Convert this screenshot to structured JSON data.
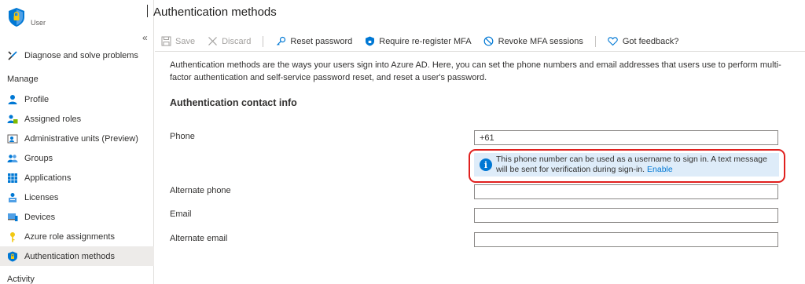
{
  "header": {
    "title": "Authentication methods",
    "user_caption": "User"
  },
  "sidebar": {
    "collapse_glyph": "«",
    "top_item": {
      "label": "Diagnose and solve problems",
      "icon": "wrench-icon"
    },
    "section_manage": "Manage",
    "items": [
      {
        "label": "Profile",
        "icon": "person-icon"
      },
      {
        "label": "Assigned roles",
        "icon": "roles-icon"
      },
      {
        "label": "Administrative units (Preview)",
        "icon": "admin-units-icon"
      },
      {
        "label": "Groups",
        "icon": "groups-icon"
      },
      {
        "label": "Applications",
        "icon": "applications-icon"
      },
      {
        "label": "Licenses",
        "icon": "licenses-icon"
      },
      {
        "label": "Devices",
        "icon": "devices-icon"
      },
      {
        "label": "Azure role assignments",
        "icon": "key-icon"
      },
      {
        "label": "Authentication methods",
        "icon": "shield-icon",
        "active": true
      }
    ],
    "section_activity": "Activity"
  },
  "toolbar": {
    "save": "Save",
    "discard": "Discard",
    "reset_password": "Reset password",
    "require_mfa": "Require re-register MFA",
    "revoke_mfa": "Revoke MFA sessions",
    "feedback": "Got feedback?"
  },
  "main": {
    "description": "Authentication methods are the ways your users sign into Azure AD. Here, you can set the phone numbers and email addresses that users use to perform multi-factor authentication and self-service password reset, and reset a user's password.",
    "section_title": "Authentication contact info",
    "phone_label": "Phone",
    "phone_value": "+61",
    "info_text": "This phone number can be used as a username to sign in. A text message will be sent for verification during sign-in.",
    "info_link": "Enable",
    "alt_phone_label": "Alternate phone",
    "alt_phone_value": "",
    "email_label": "Email",
    "email_value": "",
    "alt_email_label": "Alternate email",
    "alt_email_value": ""
  },
  "colors": {
    "accent": "#0078d4",
    "highlight": "#e0201e",
    "info_bg": "#deecf9",
    "active_nav": "#edebe9"
  }
}
